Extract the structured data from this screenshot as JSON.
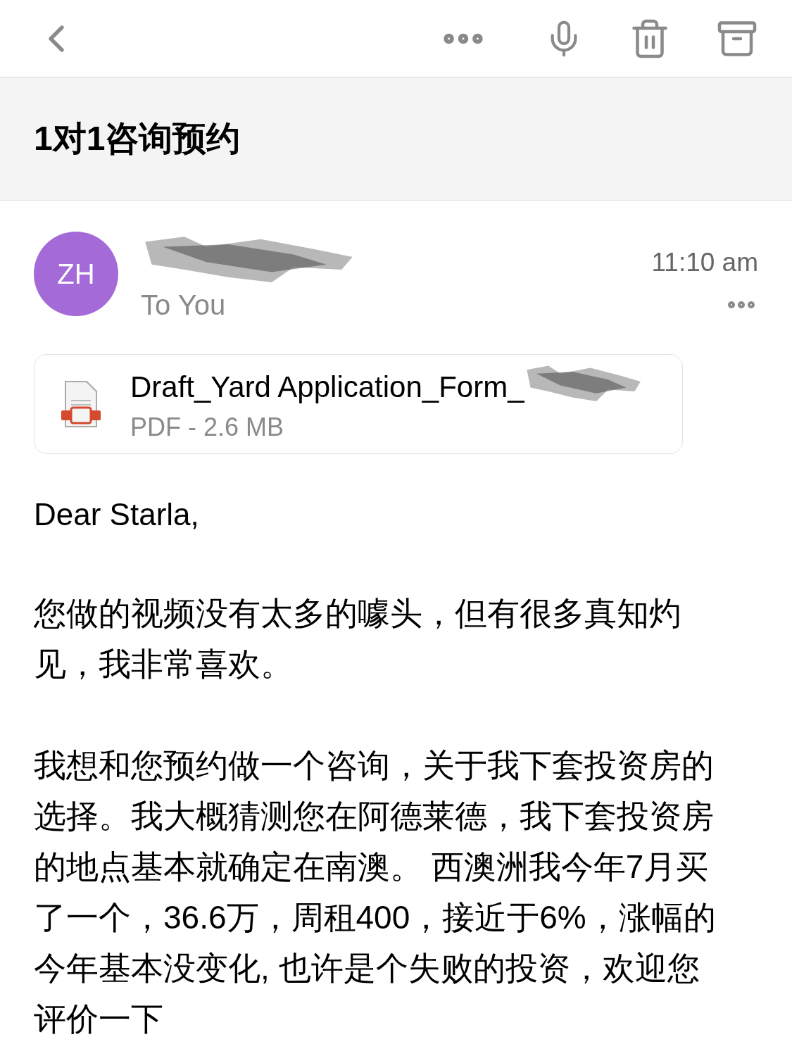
{
  "subject": "1对1咨询预约",
  "sender": {
    "initials": "ZH",
    "recipient": "To You",
    "time": "11:10 am"
  },
  "attachment": {
    "name": "Draft_Yard Application_Form_",
    "meta": "PDF - 2.6 MB"
  },
  "body": [
    "Dear Starla,",
    "您做的视频没有太多的噱头，但有很多真知灼见，我非常喜欢。",
    "我想和您预约做一个咨询，关于我下套投资房的选择。我大概猜测您在阿德莱德，我下套投资房的地点基本就确定在南澳。 西澳洲我今年7月买了一个，36.6万，周租400，接近于6%，涨幅的今年基本没变化, 也许是个失败的投资，欢迎您评价一下"
  ]
}
